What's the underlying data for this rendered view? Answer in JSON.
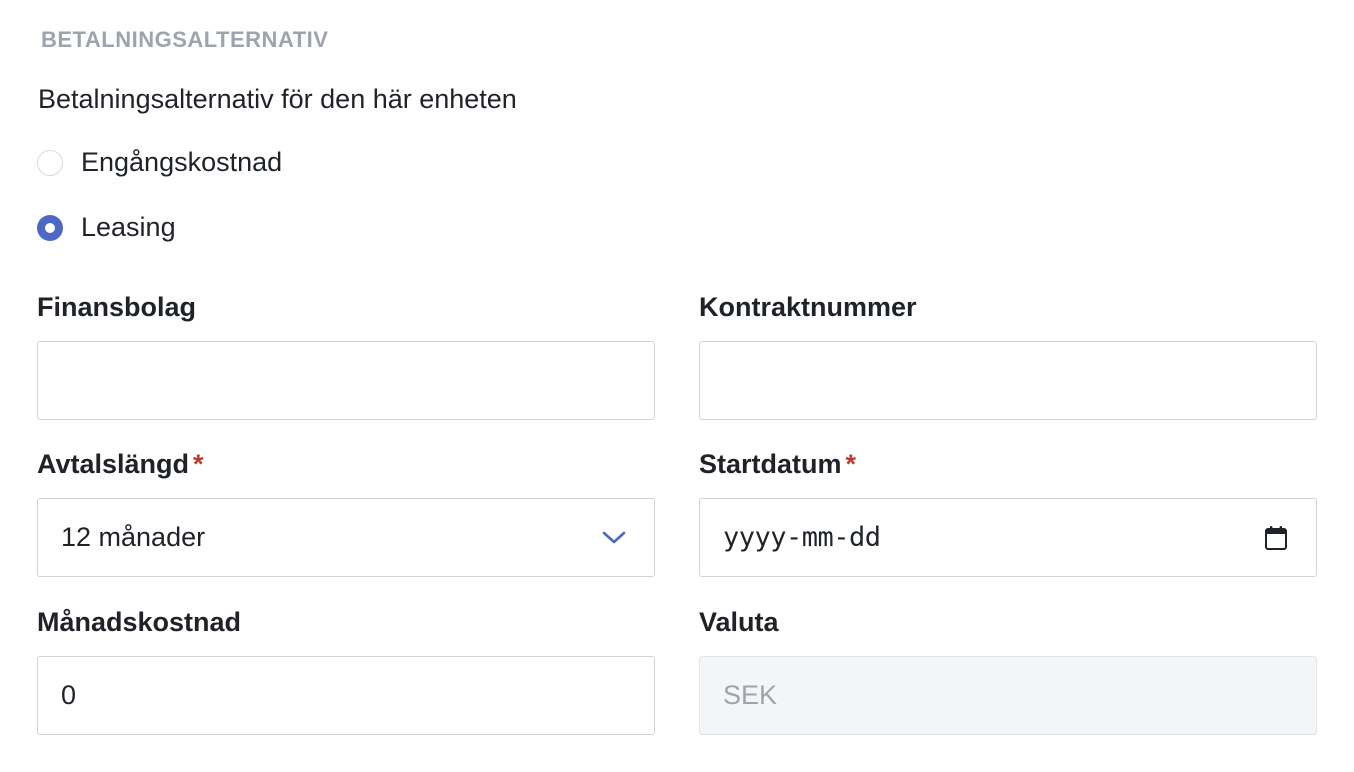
{
  "section": {
    "title": "BETALNINGSALTERNATIV",
    "question": "Betalningsalternativ för den här enheten"
  },
  "payment_options": [
    {
      "label": "Engångskostnad",
      "selected": false
    },
    {
      "label": "Leasing",
      "selected": true
    }
  ],
  "fields": {
    "finansbolag": {
      "label": "Finansbolag",
      "value": ""
    },
    "kontraktnummer": {
      "label": "Kontraktnummer",
      "value": ""
    },
    "avtalslangd": {
      "label": "Avtalslängd",
      "required_mark": "*",
      "value": "12 månader"
    },
    "startdatum": {
      "label": "Startdatum",
      "required_mark": "*",
      "placeholder": "yyyy-mm-dd"
    },
    "manadskostnad": {
      "label": "Månadskostnad",
      "value": "0"
    },
    "valuta": {
      "label": "Valuta",
      "value": "SEK",
      "disabled": true
    }
  },
  "icons": {
    "select_chevron": "chevron-down-icon",
    "date_picker": "calendar-icon"
  },
  "colors": {
    "accent": "#4d68c4",
    "required": "#c0392b",
    "muted": "#9ea4ae",
    "disabled_bg": "#f4f5f7"
  }
}
